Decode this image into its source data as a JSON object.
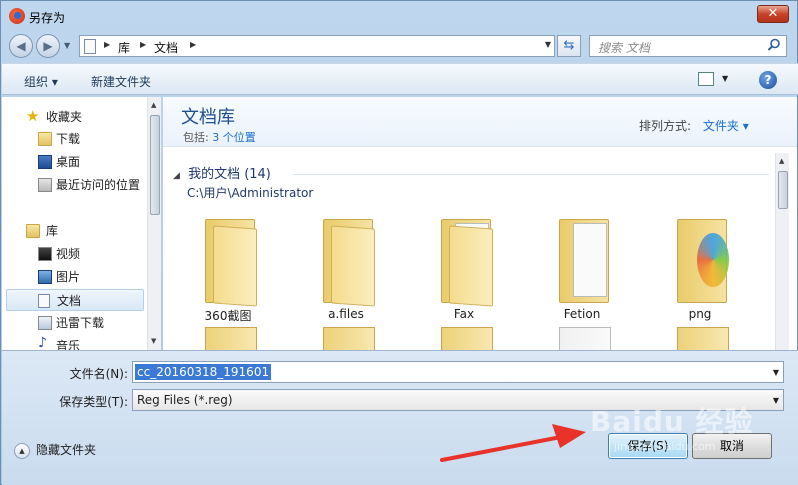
{
  "window": {
    "title": "另存为",
    "close_glyph": "✕"
  },
  "nav": {
    "back_glyph": "◀",
    "forward_glyph": "▶",
    "breadcrumbs": [
      "库",
      "文档"
    ],
    "search_placeholder": "搜索 文档"
  },
  "toolbar": {
    "organize": "组织 ▾",
    "new_folder": "新建文件夹",
    "help": "?"
  },
  "sidebar": {
    "favorites": "收藏夹",
    "fav_items": [
      "下载",
      "桌面",
      "最近访问的位置"
    ],
    "libraries": "库",
    "lib_items": [
      "视频",
      "图片",
      "文档",
      "迅雷下载",
      "音乐"
    ]
  },
  "content": {
    "title": "文档库",
    "subtitle_prefix": "包括:",
    "subtitle_link": "3 个位置",
    "arrange_label": "排列方式:",
    "arrange_value": "文件夹 ▾",
    "group_title": "我的文档 (14)",
    "group_path": "C:\\用户\\Administrator",
    "folders": [
      "360截图",
      "a.files",
      "Fax",
      "Fetion",
      "png"
    ]
  },
  "form": {
    "filename_label": "文件名(N):",
    "filename_value": "cc_20160318_191601",
    "filetype_label": "保存类型(T):",
    "filetype_value": "Reg Files (*.reg)",
    "hide_folders": "隐藏文件夹",
    "save_label": "保存(S)",
    "cancel_label": "取消"
  },
  "watermark": {
    "brand": "Baidu 经验",
    "url": "jingyan.baidu.com"
  },
  "colors": {
    "accent": "#1a6fd0",
    "arrow": "#e8322a"
  }
}
